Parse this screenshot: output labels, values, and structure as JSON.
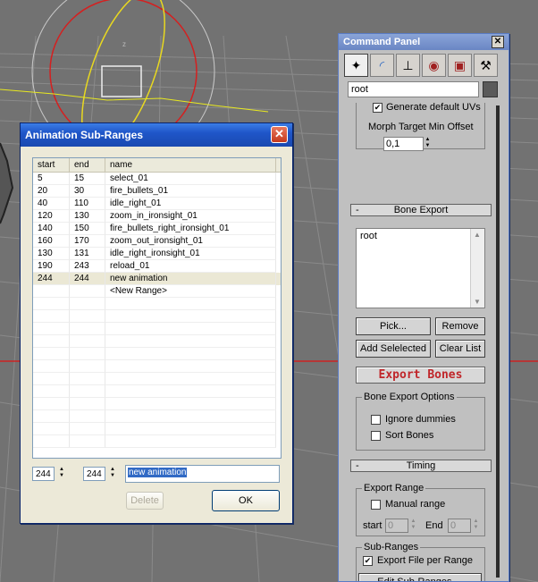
{
  "sub_ranges_dialog": {
    "title": "Animation Sub-Ranges",
    "columns": [
      "start",
      "end",
      "name"
    ],
    "rows": [
      {
        "start": "5",
        "end": "15",
        "name": "select_01"
      },
      {
        "start": "20",
        "end": "30",
        "name": "fire_bullets_01"
      },
      {
        "start": "40",
        "end": "110",
        "name": "idle_right_01"
      },
      {
        "start": "120",
        "end": "130",
        "name": "zoom_in_ironsight_01"
      },
      {
        "start": "140",
        "end": "150",
        "name": "fire_bullets_right_ironsight_01"
      },
      {
        "start": "160",
        "end": "170",
        "name": "zoom_out_ironsight_01"
      },
      {
        "start": "130",
        "end": "131",
        "name": "idle_right_ironsight_01"
      },
      {
        "start": "190",
        "end": "243",
        "name": "reload_01"
      },
      {
        "start": "244",
        "end": "244",
        "name": "new animation"
      },
      {
        "start": "",
        "end": "",
        "name": "<New Range>"
      }
    ],
    "selected_row_index": 8,
    "start_value": "244",
    "end_value": "244",
    "name_value": "new animation",
    "delete_label": "Delete",
    "ok_label": "OK"
  },
  "command_panel": {
    "title": "Command Panel",
    "tab_icons": [
      "create-icon",
      "modify-icon",
      "hierarchy-icon",
      "motion-icon",
      "display-icon",
      "utilities-icon"
    ],
    "active_tab_index": 0,
    "object_name": "root",
    "object_color": "#5a5a5a",
    "generate_uvs_label": "Generate default UVs",
    "generate_uvs_checked": true,
    "morph_target_label": "Morph Target Min Offset",
    "morph_target_value": "0,1",
    "bone_export": {
      "rollout_sign": "-",
      "rollout_title": "Bone Export",
      "list_items": [
        "root"
      ],
      "pick_label": "Pick...",
      "remove_label": "Remove",
      "add_selected_label": "Add Selelected",
      "clear_list_label": "Clear List",
      "export_bones_label": "Export Bones",
      "options_group": "Bone Export Options",
      "ignore_dummies_label": "Ignore dummies",
      "ignore_dummies_checked": false,
      "sort_bones_label": "Sort Bones",
      "sort_bones_checked": false
    },
    "timing": {
      "rollout_sign": "-",
      "rollout_title": "Timing",
      "export_range_group": "Export Range",
      "manual_range_label": "Manual range",
      "manual_range_checked": false,
      "start_label": "start",
      "start_value": "0",
      "end_label": "End",
      "end_value": "0",
      "subranges_group": "Sub-Ranges",
      "export_file_per_range_label": "Export File per Range",
      "export_file_per_range_checked": true,
      "edit_subranges_label": "Edit Sub-Ranges ..."
    }
  },
  "colors": {
    "export_bones_text": "#c0262a",
    "viewport_bg": "#727272",
    "gizmo_red": "#d42020",
    "gizmo_yellow": "#e8d820"
  }
}
